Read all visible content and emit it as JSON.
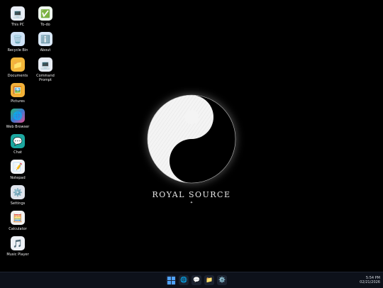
{
  "desktop": {
    "icons_col1": [
      {
        "label": "This PC",
        "icon": "computer-icon"
      },
      {
        "label": "Recycle Bin",
        "icon": "recycle-bin-icon"
      },
      {
        "label": "Documents",
        "icon": "folder-icon"
      },
      {
        "label": "Pictures",
        "icon": "pictures-icon"
      },
      {
        "label": "Web Browser",
        "icon": "globe-icon"
      },
      {
        "label": "Chat",
        "icon": "chat-icon"
      },
      {
        "label": "Notepad",
        "icon": "notepad-icon"
      },
      {
        "label": "Settings",
        "icon": "gear-icon"
      },
      {
        "label": "Calculator",
        "icon": "calculator-icon"
      },
      {
        "label": "Music Player",
        "icon": "music-icon"
      }
    ],
    "icons_col2": [
      {
        "label": "To-do",
        "icon": "checkbox-icon"
      },
      {
        "label": "About",
        "icon": "info-icon"
      },
      {
        "label": "Command\nPrompt",
        "icon": "terminal-icon"
      }
    ]
  },
  "wallpaper": {
    "brand": "ROYAL SOURCE",
    "mark": "✦"
  },
  "taskbar": {
    "pinned": [
      {
        "name": "start",
        "icon": "windows-logo-icon"
      },
      {
        "name": "web-browser",
        "icon": "globe-icon"
      },
      {
        "name": "chat",
        "icon": "chat-icon"
      },
      {
        "name": "file-explorer",
        "icon": "folder-icon"
      },
      {
        "name": "settings",
        "icon": "gear-icon"
      }
    ],
    "clock": {
      "time": "5:54 PM",
      "date": "02/21/2026"
    }
  },
  "colors": {
    "background": "#000000",
    "taskbar": "#0d111a",
    "accent": "#4fa3ff"
  }
}
